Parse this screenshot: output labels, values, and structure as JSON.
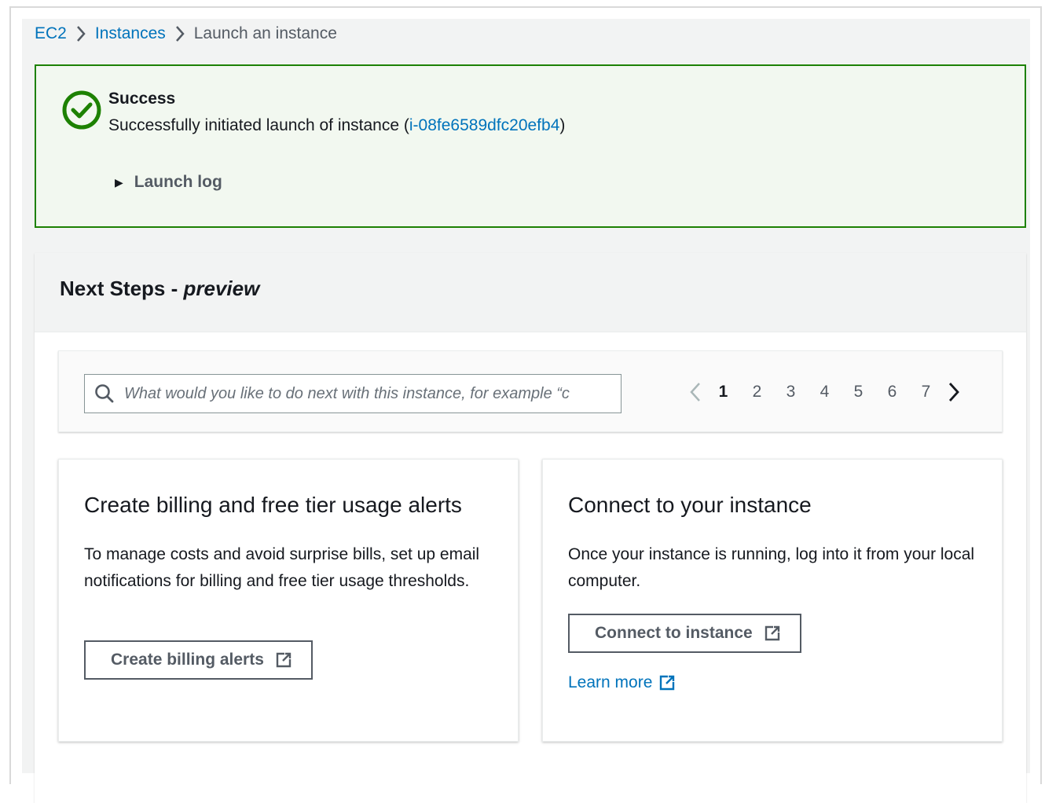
{
  "breadcrumb": {
    "items": [
      {
        "label": "EC2"
      },
      {
        "label": "Instances"
      },
      {
        "label": "Launch an instance"
      }
    ]
  },
  "flash": {
    "status": "success",
    "title": "Success",
    "message_prefix": "Successfully initiated launch of instance (",
    "instance_id": "i-08fe6589dfc20efb4",
    "message_suffix": ")",
    "expandable_label": "Launch log"
  },
  "next_steps": {
    "title": "Next Steps - ",
    "title_emphasis": "preview",
    "search": {
      "value": "",
      "placeholder": "What would you like to do next with this instance, for example “c"
    },
    "pagination": {
      "pages": [
        "1",
        "2",
        "3",
        "4",
        "5",
        "6",
        "7"
      ],
      "current": "1"
    },
    "cards": [
      {
        "title": "Create billing and free tier usage alerts",
        "text": "To manage costs and avoid surprise bills, set up email notifications for billing and free tier usage thresholds.",
        "button_label": "Create billing alerts"
      },
      {
        "title": "Connect to your instance",
        "text": "Once your instance is running, log into it from your local computer.",
        "button_label": "Connect to instance",
        "link_label": "Learn more"
      }
    ]
  },
  "colors": {
    "link": "#0073bb",
    "success": "#1d8102",
    "success_bg": "#f2f8f0",
    "button_border": "#545b64"
  },
  "icons": {
    "breadcrumb_separator": "chevron-right-icon",
    "flash": "status-success-icon",
    "expand": "caret-right-icon",
    "search": "search-icon",
    "external": "external-link-icon"
  }
}
